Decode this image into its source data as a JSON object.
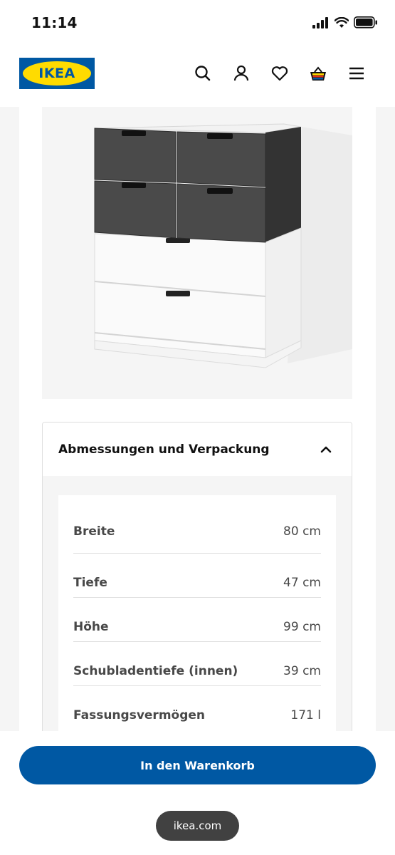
{
  "status_bar": {
    "time": "11:14"
  },
  "header": {
    "logo_text": "IKEA",
    "icons": [
      "search-icon",
      "user-icon",
      "heart-icon",
      "basket-icon",
      "menu-icon"
    ]
  },
  "accordion": {
    "title": "Abmessungen und Verpackung",
    "specs": [
      {
        "label": "Breite",
        "value": "80 cm"
      },
      {
        "label": "Tiefe",
        "value": "47 cm"
      },
      {
        "label": "Höhe",
        "value": "99 cm"
      },
      {
        "label": "Schubladentiefe (innen)",
        "value": "39 cm"
      },
      {
        "label": "Fassungsvermögen",
        "value": "171 l"
      }
    ]
  },
  "cart_button": {
    "label": "In den Warenkorb"
  },
  "browser": {
    "url": "ikea.com"
  },
  "colors": {
    "brand_blue": "#0058a3",
    "brand_yellow": "#ffdb00"
  }
}
